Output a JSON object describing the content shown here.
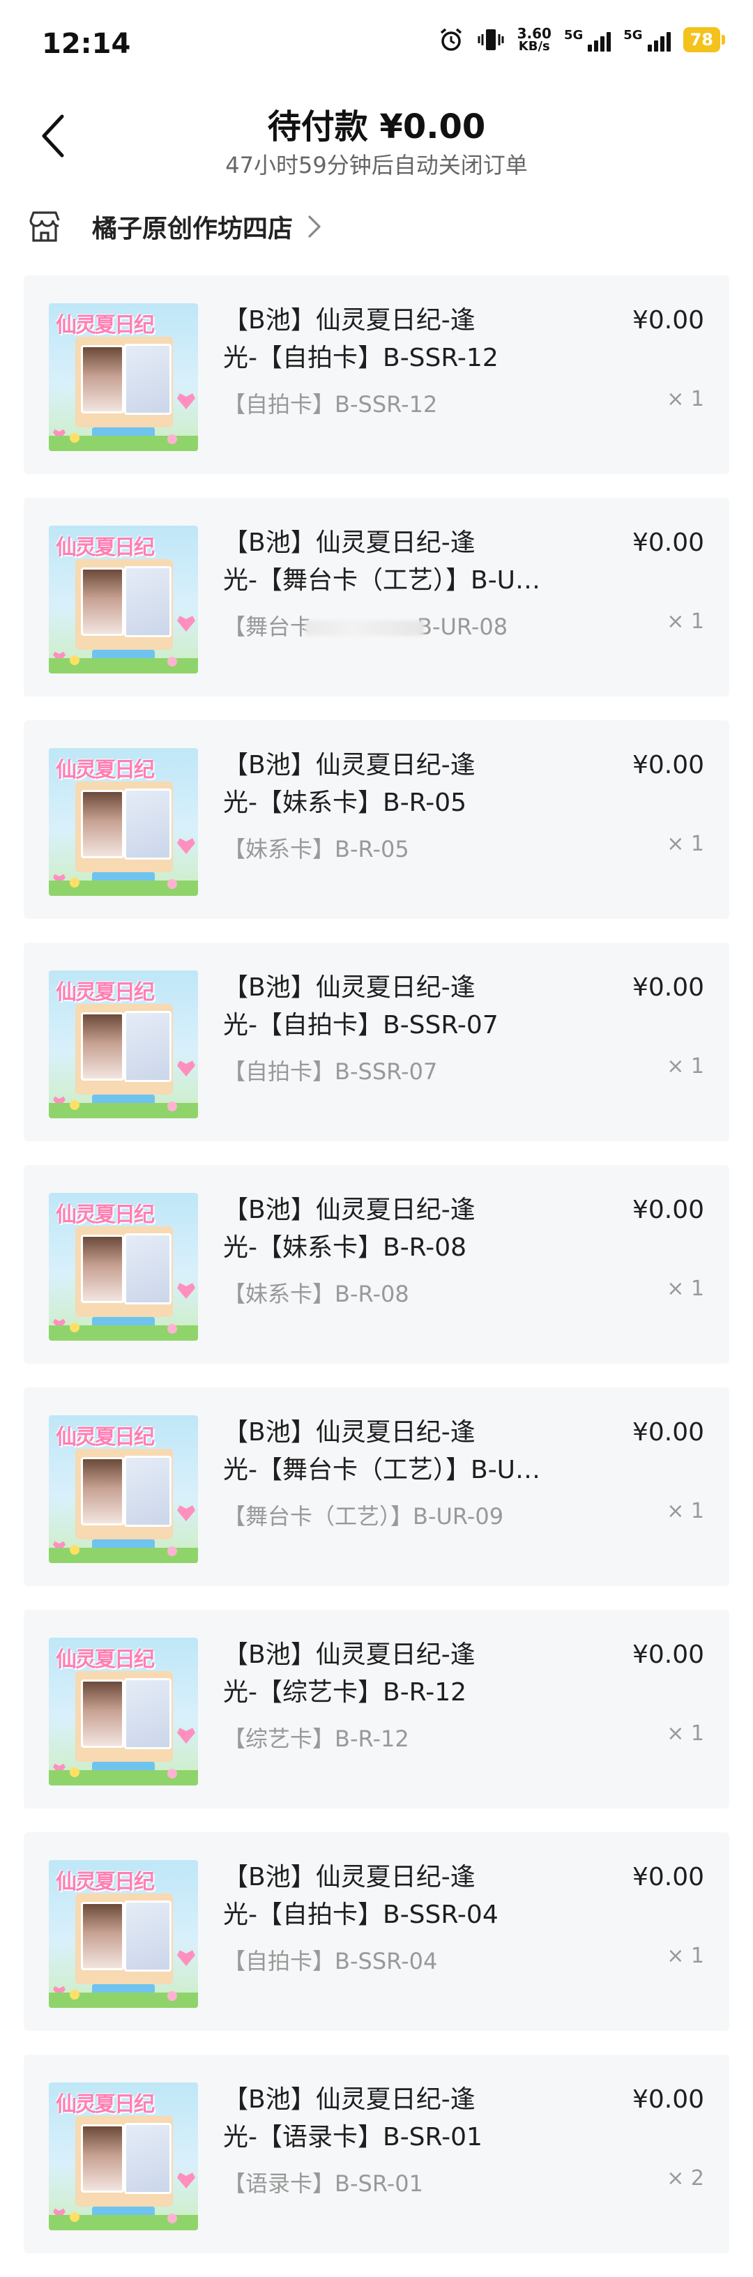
{
  "status_bar": {
    "time": "12:14",
    "net_speed_value": "3.60",
    "net_speed_unit": "KB/s",
    "sim1_label": "5G",
    "sim2_label": "5G",
    "battery": "78",
    "battery_color": "#f4c21c"
  },
  "header": {
    "title": "待付款 ¥0.00",
    "subtitle": "47小时59分钟后自动关闭订单"
  },
  "store": {
    "name": "橘子原创作坊四店"
  },
  "items": [
    {
      "title_l1": "【B池】仙灵夏日纪-逢",
      "title_l2": "光-【自拍卡】B-SSR-12",
      "spec": "【自拍卡】B-SSR-12",
      "price": "¥0.00",
      "qty": "× 1"
    },
    {
      "title_l1": "【B池】仙灵夏日纪-逢",
      "title_l2": "光-【舞台卡（工艺）】B-U…",
      "spec_a": "【舞台卡",
      "spec_b": "B-UR-08",
      "price": "¥0.00",
      "qty": "× 1"
    },
    {
      "title_l1": "【B池】仙灵夏日纪-逢",
      "title_l2": "光-【妹系卡】B-R-05",
      "spec": "【妹系卡】B-R-05",
      "price": "¥0.00",
      "qty": "× 1"
    },
    {
      "title_l1": "【B池】仙灵夏日纪-逢",
      "title_l2": "光-【自拍卡】B-SSR-07",
      "spec": "【自拍卡】B-SSR-07",
      "price": "¥0.00",
      "qty": "× 1"
    },
    {
      "title_l1": "【B池】仙灵夏日纪-逢",
      "title_l2": "光-【妹系卡】B-R-08",
      "spec": "【妹系卡】B-R-08",
      "price": "¥0.00",
      "qty": "× 1"
    },
    {
      "title_l1": "【B池】仙灵夏日纪-逢",
      "title_l2": "光-【舞台卡（工艺）】B-U…",
      "spec": "【舞台卡（工艺）】B-UR-09",
      "price": "¥0.00",
      "qty": "× 1"
    },
    {
      "title_l1": "【B池】仙灵夏日纪-逢",
      "title_l2": "光-【综艺卡】B-R-12",
      "spec": "【综艺卡】B-R-12",
      "price": "¥0.00",
      "qty": "× 1"
    },
    {
      "title_l1": "【B池】仙灵夏日纪-逢",
      "title_l2": "光-【自拍卡】B-SSR-04",
      "spec": "【自拍卡】B-SSR-04",
      "price": "¥0.00",
      "qty": "× 1"
    },
    {
      "title_l1": "【B池】仙灵夏日纪-逢",
      "title_l2": "光-【语录卡】B-SR-01",
      "spec": "【语录卡】B-SR-01",
      "price": "¥0.00",
      "qty": "× 2"
    }
  ],
  "thumbnail_logo": "仙灵夏日纪"
}
